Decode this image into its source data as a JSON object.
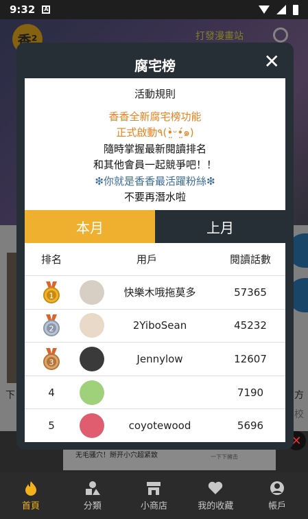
{
  "status_bar": {
    "time": "9:32"
  },
  "background_app": {
    "logo_text": "香²",
    "header_text": "打發漫畫站",
    "side_text_left": "下",
    "side_text_right": "方",
    "side_text_right2": "校",
    "ad": {
      "text": "无毛骚穴！掰开小穴超紧致",
      "sub": "一下下擁击"
    }
  },
  "modal": {
    "title": "腐宅榜",
    "close_label": "✕",
    "rules": {
      "heading": "活動規則",
      "line1": "香香全新腐宅榜功能",
      "line2": "正式啟動٩(•̤̀ᵕ•̤́๑)",
      "line3": "隨時掌握最新閱讀排名",
      "line4": "和其他會員一起競爭吧！！",
      "line5": "❇你就是香香最活躍粉絲❇",
      "line6": "不要再潛水啦"
    },
    "tabs": [
      {
        "label": "本月",
        "active": true
      },
      {
        "label": "上月",
        "active": false
      }
    ],
    "columns": {
      "rank": "排名",
      "user": "用戶",
      "reads": "閱讀話數"
    },
    "rows": [
      {
        "rank": "1",
        "medal": "gold",
        "user": "快樂木哦拖莫多",
        "reads": "57365",
        "avatar_color": "#d8cfc4"
      },
      {
        "rank": "2",
        "medal": "silver",
        "user": "2YiboSean",
        "reads": "45232",
        "avatar_color": "#e8d9c8"
      },
      {
        "rank": "3",
        "medal": "bronze",
        "user": "Jennylow",
        "reads": "12607",
        "avatar_color": "#3a3a3a"
      },
      {
        "rank": "4",
        "medal": "none",
        "user": "",
        "reads": "7190",
        "avatar_color": "#9fd07a"
      },
      {
        "rank": "5",
        "medal": "none",
        "user": "coyotewood",
        "reads": "5696",
        "avatar_color": "#e05d6f"
      }
    ]
  },
  "bottom_nav": [
    {
      "label": "首頁",
      "icon": "fire-icon",
      "active": true
    },
    {
      "label": "分類",
      "icon": "shapes-icon",
      "active": false
    },
    {
      "label": "小商店",
      "icon": "store-icon",
      "active": false
    },
    {
      "label": "我的收藏",
      "icon": "heart-icon",
      "active": false
    },
    {
      "label": "帳戶",
      "icon": "user-icon",
      "active": false
    }
  ],
  "colors": {
    "accent": "#efb02f",
    "modal_bg": "#262e36",
    "orange_text": "#e8821e",
    "blue_text": "#3b6b9a"
  }
}
